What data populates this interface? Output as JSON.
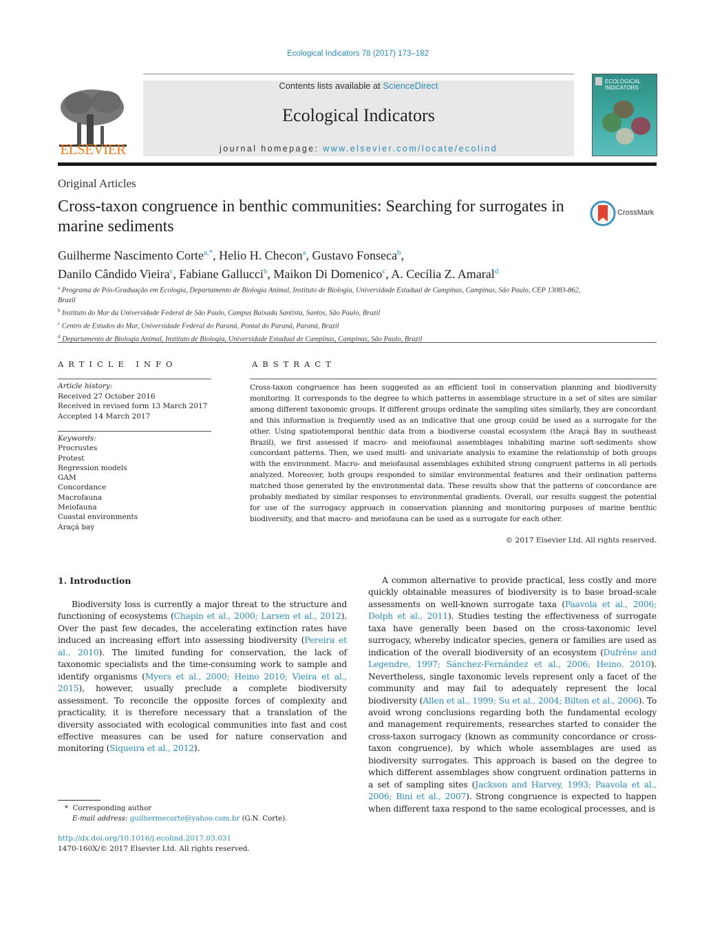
{
  "header": {
    "citation": "Ecological Indicators 78 (2017) 173–182",
    "contents_prefix": "Contents lists available at ",
    "contents_link": "ScienceDirect",
    "journal_name": "Ecological Indicators",
    "homepage_prefix": "journal homepage: ",
    "homepage_url": "www.elsevier.com/locate/ecolind",
    "publisher_logo_text": "ELSEVIER",
    "cover_title_line1": "ECOLOGICAL",
    "cover_title_line2": "INDICATORS",
    "crossmark_label": "CrossMark"
  },
  "article": {
    "section_type": "Original Articles",
    "title": "Cross-taxon congruence in benthic communities: Searching for surrogates in marine sediments",
    "authors": [
      {
        "name": "Guilherme Nascimento Corte",
        "sup": "a,*",
        "sep": ", "
      },
      {
        "name": "Helio H. Checon",
        "sup": "a",
        "sep": ", "
      },
      {
        "name": "Gustavo Fonseca",
        "sup": "b",
        "sep": ","
      },
      {
        "name": "Danilo Cândido Vieira",
        "sup": "c",
        "sep": ", "
      },
      {
        "name": "Fabiane Gallucci",
        "sup": "b",
        "sep": ", "
      },
      {
        "name": "Maikon Di Domenico",
        "sup": "c",
        "sep": ", "
      },
      {
        "name": "A. Cecília Z. Amaral",
        "sup": "d",
        "sep": ""
      }
    ],
    "affiliations": [
      {
        "key": "a",
        "text": "Programa de Pós-Graduação em Ecologia, Departamento de Biologia Animal, Instituto de Biologia, Universidade Estadual de Campinas, Campinas, São Paulo, CEP 13083-862, Brazil"
      },
      {
        "key": "b",
        "text": "Instituto do Mar da Universidade Federal de São Paulo, Campus Baixada Santista, Santos, São Paulo, Brazil"
      },
      {
        "key": "c",
        "text": "Centro de Estudos do Mar, Universidade Federal do Paraná, Pontal do Paraná, Paraná, Brazil"
      },
      {
        "key": "d",
        "text": "Departamento de Biologia Animal, Instituto de Biologia, Universidade Estadual de Campinas, Campinas, São Paulo, Brazil"
      }
    ]
  },
  "article_info": {
    "heading": "ARTICLE INFO",
    "history_label": "Article history:",
    "history": [
      "Received 27 October 2016",
      "Received in revised form 13 March 2017",
      "Accepted 14 March 2017"
    ],
    "keywords_label": "Keywords:",
    "keywords": [
      "Procrustes",
      "Protest",
      "Regression models",
      "GAM",
      "Concordance",
      "Macrofauna",
      "Meiofauna",
      "Coastal environments",
      "Araçá bay"
    ]
  },
  "abstract": {
    "heading": "ABSTRACT",
    "text": "Cross-taxon congruence has been suggested as an efficient tool in conservation planning and biodiversity monitoring. It corresponds to the degree to which patterns in assemblage structure in a set of sites are similar among different taxonomic groups. If different groups ordinate the sampling sites similarly, they are concordant and this information is frequently used as an indicative that one group could be used as a surrogate for the other. Using spatiotemporal benthic data from a biodiverse coastal ecosystem (the Araçá Bay in southeast Brazil), we first assessed if macro- and meiofaunal assemblages inhabiting marine soft-sediments show concordant patterns. Then, we used multi- and univariate analysis to examine the relationship of both groups with the environment. Macro- and meiofaunal assemblages exhibited strong congruent patterns in all periods analyzed. Moreover, both groups responded to similar environmental features and their ordination patterns matched those generated by the environmental data. These results show that the patterns of concordance are probably mediated by similar responses to environmental gradients. Overall, our results suggest the potential for use of the surrogacy approach in conservation planning and monitoring purposes of marine benthic biodiversity, and that macro- and meiofauna can be used as a surrogate for each other.",
    "copyright": "© 2017 Elsevier Ltd. All rights reserved."
  },
  "introduction": {
    "heading": "1.  Introduction",
    "left_paragraph": [
      {
        "t": "Biodiversity loss is currently a major threat to the structure and functioning of ecosystems ("
      },
      {
        "t": "Chapin et al., 2000; Larsen et al., 2012",
        "link": true
      },
      {
        "t": "). Over the past few decades, the accelerating extinction rates have induced an increasing effort into assessing biodiversity ("
      },
      {
        "t": "Pereira et al., 2010",
        "link": true
      },
      {
        "t": "). The limited funding for conservation, the lack of taxonomic specialists and the time-consuming work to sample and identify organisms ("
      },
      {
        "t": "Myers et al., 2000; Heino 2010; Vieira et al., 2015",
        "link": true
      },
      {
        "t": "), however, usually preclude a complete biodiversity assessment. To reconcile the opposite forces of complexity and practicality, it is therefore necessary that a translation of the diversity associated with ecological communities into fast and cost effective measures can be used for nature conservation and monitoring ("
      },
      {
        "t": "Siqueira et al., 2012",
        "link": true
      },
      {
        "t": ")."
      }
    ],
    "right_paragraph": [
      {
        "t": "A common alternative to provide practical, less costly and more quickly obtainable measures of biodiversity is to base broad-scale assessments on well-known surrogate taxa ("
      },
      {
        "t": "Paavola et al., 2006; Dolph et al., 2011",
        "link": true
      },
      {
        "t": "). Studies testing the effectiveness of surrogate taxa have generally been based on the cross-taxonomic level surrogacy, whereby indicator species, genera or families are used as indication of the overall biodiversity of an ecosystem ("
      },
      {
        "t": "Dufrêne and Legendre, 1997; Sánchez-Fernández et al., 2006; Heino, 2010",
        "link": true
      },
      {
        "t": "). Nevertheless, single taxonomic levels represent only a facet of the community and may fail to adequately represent the local biodiversity ("
      },
      {
        "t": "Allen et al., 1999; Su et al., 2004; Bilton et al., 2006",
        "link": true
      },
      {
        "t": "). To avoid wrong conclusions regarding both the fundamental ecology and management requirements, researches started to consider the cross-taxon surrogacy (known as community concordance or cross-taxon congruence), by which whole assemblages are used as biodiversity surrogates. This approach is based on the degree to which different assemblages show congruent ordination patterns in a set of sampling sites ("
      },
      {
        "t": "Jackson and Harvey, 1993; Paavola et al., 2006; Bini et al., 2007",
        "link": true
      },
      {
        "t": "). Strong congruence is expected to happen when different taxa respond to the same ecological processes, and is"
      }
    ]
  },
  "footnotes": {
    "corresponding_mark": "*",
    "corresponding_label": "Corresponding author",
    "email_label": "E-mail address: ",
    "email": "guilhermecorte@yahoo.com.br",
    "email_suffix": " (G.N. Corte).",
    "doi": "http://dx.doi.org/10.1016/j.ecolind.2017.03.031",
    "issn_line": "1470-160X/© 2017 Elsevier Ltd. All rights reserved."
  }
}
